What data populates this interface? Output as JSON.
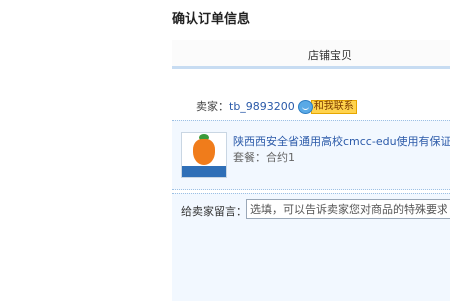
{
  "page_title": "确认订单信息",
  "column_header": "店铺宝贝",
  "seller": {
    "label": "卖家：",
    "name": "tb_9893200",
    "contact_label": "和我联系",
    "contact_icon": "wangwang-icon"
  },
  "item": {
    "title": "陕西西安全省通用高校cmcc-edu使用有保证有",
    "package": "套餐：合约1",
    "thumbnail_icon": "product-image"
  },
  "message": {
    "label": "给卖家留言：",
    "value": "选填，可以告诉卖家您对商品的特殊要求，"
  },
  "colors": {
    "link": "#2b5aa9",
    "row_bg": "#f2f8ff",
    "header_border": "#c7dcf2",
    "contact_bg": "#ffd34d"
  }
}
